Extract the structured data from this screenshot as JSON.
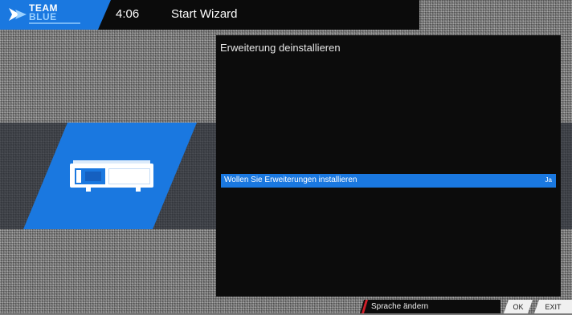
{
  "header": {
    "logo_line1": "TEAM",
    "logo_line2": "BLUE",
    "clock": "4:06",
    "title": "Start Wizard"
  },
  "panel": {
    "title": "Erweiterung deinstallieren",
    "rows": [
      {
        "label": "Wollen Sie Erweiterungen installieren",
        "value": "Ja",
        "selected": true
      }
    ]
  },
  "footer": {
    "red_hint": "Sprache ändern",
    "ok_key": "OK",
    "exit_key": "EXIT"
  },
  "colors": {
    "accent": "#1a78e0",
    "red_key": "#d0202a",
    "panel_bg": "#0c0c0c"
  },
  "icons": {
    "logo": "team-blue-arrow-icon",
    "device": "set-top-box-icon"
  }
}
